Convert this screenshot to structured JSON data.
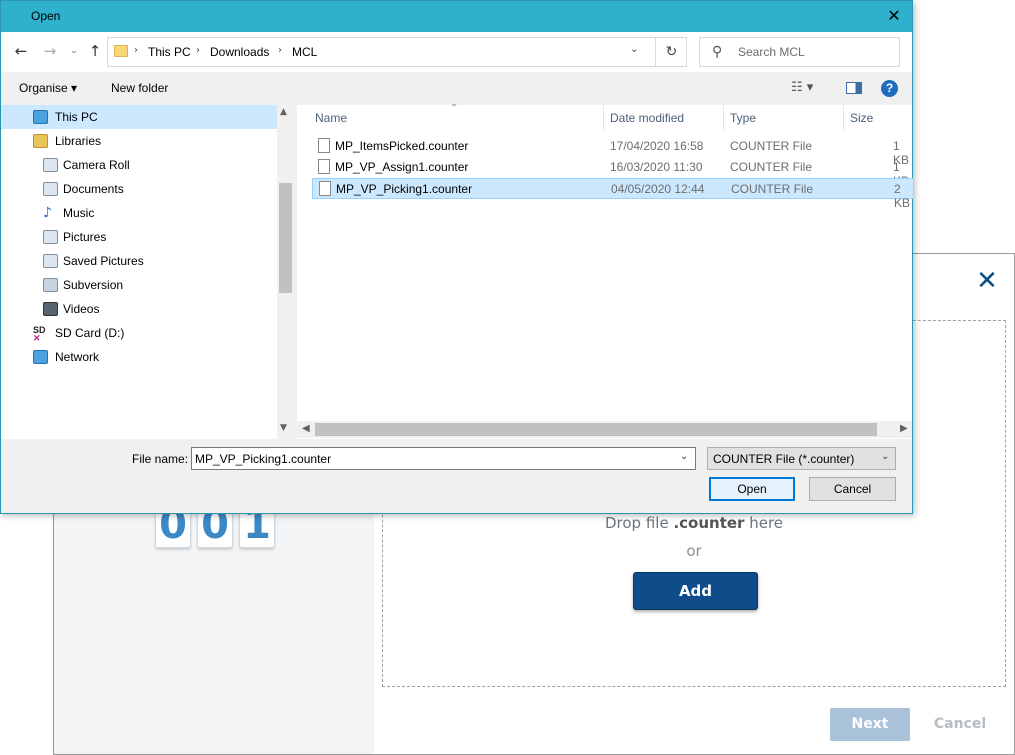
{
  "dialog": {
    "title": "Open",
    "breadcrumbs": [
      "This PC",
      "Downloads",
      "MCL"
    ],
    "search_placeholder": "Search MCL",
    "toolbar": {
      "organise": "Organise ▾",
      "new_folder": "New folder"
    },
    "nav_items": [
      {
        "label": "This PC",
        "icon": "computer-icon",
        "selected": true
      },
      {
        "label": "Libraries",
        "icon": "libraries-icon"
      },
      {
        "label": "Camera Roll",
        "icon": "folder-library-icon"
      },
      {
        "label": "Documents",
        "icon": "documents-icon"
      },
      {
        "label": "Music",
        "icon": "music-icon"
      },
      {
        "label": "Pictures",
        "icon": "pictures-icon"
      },
      {
        "label": "Saved Pictures",
        "icon": "folder-library-icon"
      },
      {
        "label": "Subversion",
        "icon": "subversion-icon"
      },
      {
        "label": "Videos",
        "icon": "videos-icon"
      },
      {
        "label": "SD Card (D:)",
        "icon": "sd-card-icon"
      },
      {
        "label": "Network",
        "icon": "network-icon"
      }
    ],
    "columns": {
      "name": "Name",
      "date": "Date modified",
      "type": "Type",
      "size": "Size"
    },
    "files": [
      {
        "name": "MP_ItemsPicked.counter",
        "date": "17/04/2020 16:58",
        "type": "COUNTER File",
        "size": "1 KB"
      },
      {
        "name": "MP_VP_Assign1.counter",
        "date": "16/03/2020 11:30",
        "type": "COUNTER File",
        "size": "1 KB"
      },
      {
        "name": "MP_VP_Picking1.counter",
        "date": "04/05/2020 12:44",
        "type": "COUNTER File",
        "size": "2 KB",
        "selected": true
      }
    ],
    "file_name_label": "File name:",
    "file_name_value": "MP_VP_Picking1.counter",
    "file_type_value": "COUNTER File (*.counter)",
    "open_label": "Open",
    "cancel_label": "Cancel"
  },
  "background": {
    "close_glyph": "✕",
    "counter_digits": [
      "0",
      "0",
      "1"
    ],
    "drop_text_prefix": "Drop file ",
    "drop_text_bold": ".counter",
    "drop_text_suffix": " here",
    "or_text": "or",
    "add_label": "Add",
    "next_label": "Next",
    "cancel_label": "Cancel"
  }
}
